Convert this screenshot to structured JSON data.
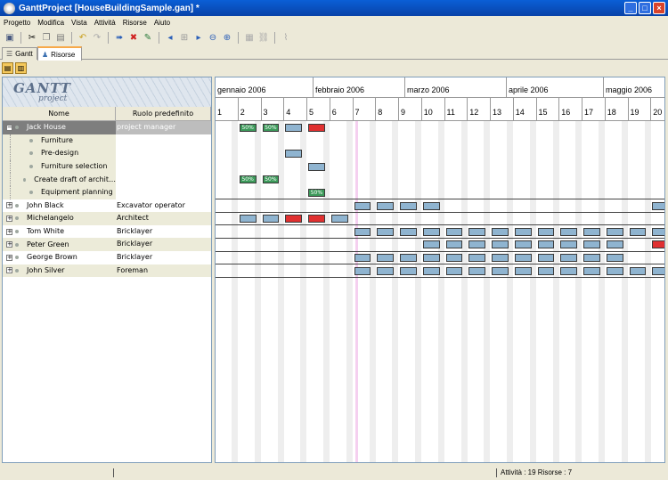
{
  "window": {
    "title": "GanttProject [HouseBuildingSample.gan] *"
  },
  "menu": [
    "Progetto",
    "Modifica",
    "Vista",
    "Attività",
    "Risorse",
    "Aiuto"
  ],
  "tabs": [
    {
      "label": "Gantt"
    },
    {
      "label": "Risorse"
    }
  ],
  "logo": {
    "text": "GANTT",
    "sub": "project"
  },
  "table": {
    "headers": [
      "Nome",
      "Ruolo predefinito"
    ],
    "rows": [
      {
        "name": "Jack House",
        "role": "project manager",
        "type": "resource",
        "expanded": true,
        "selected": true
      },
      {
        "name": "Furniture",
        "role": "",
        "type": "task"
      },
      {
        "name": "Pre-design",
        "role": "",
        "type": "task"
      },
      {
        "name": "Furniture selection",
        "role": "",
        "type": "task"
      },
      {
        "name": "Create draft of archit…",
        "role": "",
        "type": "task"
      },
      {
        "name": "Equipment planning",
        "role": "",
        "type": "task"
      },
      {
        "name": "John Black",
        "role": "Excavator operator",
        "type": "resource"
      },
      {
        "name": "Michelangelo",
        "role": "Architect",
        "type": "resource"
      },
      {
        "name": "Tom White",
        "role": "Bricklayer",
        "type": "resource"
      },
      {
        "name": "Peter Green",
        "role": "Bricklayer",
        "type": "resource"
      },
      {
        "name": "George Brown",
        "role": "Bricklayer",
        "type": "resource"
      },
      {
        "name": "John Silver",
        "role": "Foreman",
        "type": "resource"
      }
    ]
  },
  "timeline": {
    "months": [
      "gennaio 2006",
      "febbraio 2006",
      "marzo 2006",
      "aprile 2006",
      "maggio 2006"
    ],
    "weeks": [
      "1",
      "2",
      "3",
      "4",
      "5",
      "6",
      "7",
      "8",
      "9",
      "10",
      "11",
      "12",
      "13",
      "14",
      "15",
      "16",
      "17",
      "18",
      "19",
      "20"
    ]
  },
  "chart": {
    "rows": [
      [
        [
          1,
          "g",
          "50%"
        ],
        [
          2,
          "g",
          "50%"
        ],
        [
          3,
          "n",
          ""
        ],
        [
          4,
          "r",
          ""
        ]
      ],
      [],
      [
        [
          3,
          "n",
          ""
        ]
      ],
      [
        [
          4,
          "n",
          ""
        ]
      ],
      [
        [
          1,
          "g",
          "50%"
        ],
        [
          2,
          "g",
          "50%"
        ]
      ],
      [
        [
          4,
          "g",
          "50%"
        ]
      ],
      [
        [
          6,
          "n",
          ""
        ],
        [
          7,
          "n",
          ""
        ],
        [
          8,
          "n",
          ""
        ],
        [
          9,
          "n",
          ""
        ],
        [
          19,
          "n",
          ""
        ]
      ],
      [
        [
          1,
          "n",
          ""
        ],
        [
          2,
          "n",
          ""
        ],
        [
          3,
          "r",
          ""
        ],
        [
          4,
          "r",
          ""
        ],
        [
          5,
          "n",
          ""
        ]
      ],
      [
        [
          6,
          "n",
          ""
        ],
        [
          7,
          "n",
          ""
        ],
        [
          8,
          "n",
          ""
        ],
        [
          9,
          "n",
          ""
        ],
        [
          10,
          "n",
          ""
        ],
        [
          11,
          "n",
          ""
        ],
        [
          12,
          "n",
          ""
        ],
        [
          13,
          "n",
          ""
        ],
        [
          14,
          "n",
          ""
        ],
        [
          15,
          "n",
          ""
        ],
        [
          16,
          "n",
          ""
        ],
        [
          17,
          "n",
          ""
        ],
        [
          18,
          "n",
          ""
        ],
        [
          19,
          "n",
          ""
        ]
      ],
      [
        [
          9,
          "n",
          ""
        ],
        [
          10,
          "n",
          ""
        ],
        [
          11,
          "n",
          ""
        ],
        [
          12,
          "n",
          ""
        ],
        [
          13,
          "n",
          ""
        ],
        [
          14,
          "n",
          ""
        ],
        [
          15,
          "n",
          ""
        ],
        [
          16,
          "n",
          ""
        ],
        [
          17,
          "n",
          ""
        ],
        [
          19,
          "r",
          ""
        ]
      ],
      [
        [
          6,
          "n",
          ""
        ],
        [
          7,
          "n",
          ""
        ],
        [
          8,
          "n",
          ""
        ],
        [
          9,
          "n",
          ""
        ],
        [
          10,
          "n",
          ""
        ],
        [
          11,
          "n",
          ""
        ],
        [
          12,
          "n",
          ""
        ],
        [
          13,
          "n",
          ""
        ],
        [
          14,
          "n",
          ""
        ],
        [
          15,
          "n",
          ""
        ],
        [
          16,
          "n",
          ""
        ],
        [
          17,
          "n",
          ""
        ]
      ],
      [
        [
          6,
          "n",
          ""
        ],
        [
          7,
          "n",
          ""
        ],
        [
          8,
          "n",
          ""
        ],
        [
          9,
          "n",
          ""
        ],
        [
          10,
          "n",
          ""
        ],
        [
          11,
          "n",
          ""
        ],
        [
          12,
          "n",
          ""
        ],
        [
          13,
          "n",
          ""
        ],
        [
          14,
          "n",
          ""
        ],
        [
          15,
          "n",
          ""
        ],
        [
          16,
          "n",
          ""
        ],
        [
          17,
          "n",
          ""
        ],
        [
          18,
          "n",
          ""
        ],
        [
          19,
          "n",
          ""
        ]
      ]
    ]
  },
  "status": {
    "text": "Attività : 19  Risorse : 7"
  },
  "colors": {
    "bar": "#8fb4d0",
    "overload": "#e03030",
    "complete": "#3c9a5a"
  }
}
